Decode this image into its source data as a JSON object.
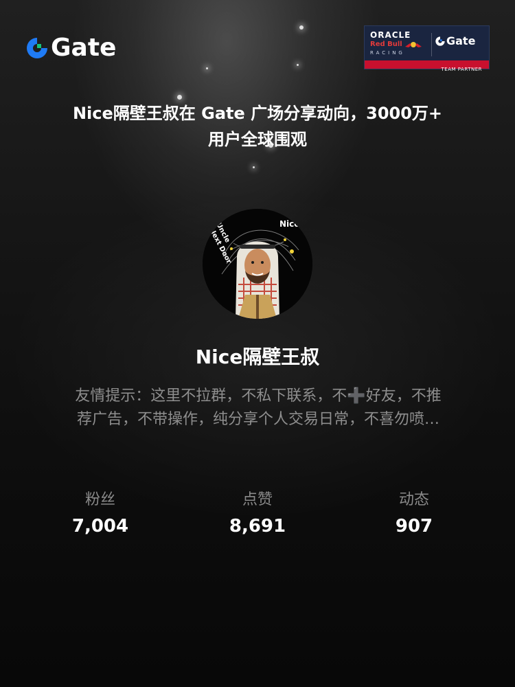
{
  "brand": {
    "logo_icon": "gate-logo-icon",
    "name": "Gate",
    "accent_color": "#1f7bf5",
    "accent_green": "#14c47c"
  },
  "partner_badge": {
    "oracle": "ORACLE",
    "red_bull": "Red Bull",
    "racing": "RACING",
    "gate": "Gate",
    "strip": "TEAM PARTNER",
    "background_color": "#1a2540",
    "strip_color": "#c8102e"
  },
  "headline": {
    "line1": "Nice隔壁王叔在 Gate 广场分享动向，3000万+",
    "line2": "用户全球围观"
  },
  "profile": {
    "avatar_icon": "avatar-illustration",
    "avatar_text_right": "Nice",
    "avatar_text_left_1": "Uncle",
    "avatar_text_left_2": "Next Door",
    "username": "Nice隔壁王叔",
    "bio_line1": "友情提示：这里不拉群，不私下联系，不➕好友，不推",
    "bio_line2": "荐广告，不带操作，纯分享个人交易日常，不喜勿喷…"
  },
  "stats": [
    {
      "label": "粉丝",
      "value": "7,004"
    },
    {
      "label": "点赞",
      "value": "8,691"
    },
    {
      "label": "动态",
      "value": "907"
    }
  ]
}
